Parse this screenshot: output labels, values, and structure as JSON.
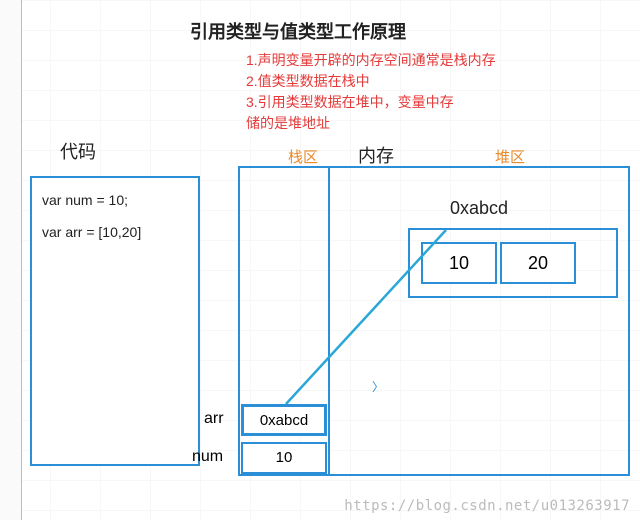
{
  "title": "引用类型与值类型工作原理",
  "notes": {
    "line1": "1.声明变量开辟的内存空间通常是栈内存",
    "line2": "2.值类型数据在栈中",
    "line3": "3.引用类型数据在堆中，变量中存",
    "line4": "储的是堆地址"
  },
  "labels": {
    "code": "代码",
    "stack": "栈区",
    "memory": "内存",
    "heap": "堆区"
  },
  "code": {
    "line1": "var num = 10;",
    "line2": "var arr = [10,20]"
  },
  "stack": {
    "arr_label": "arr",
    "arr_value": "0xabcd",
    "num_label": "num",
    "num_value": "10"
  },
  "heap": {
    "address": "0xabcd",
    "values": {
      "v0": "10",
      "v1": "20"
    }
  },
  "watermark": "https://blog.csdn.net/u013263917"
}
